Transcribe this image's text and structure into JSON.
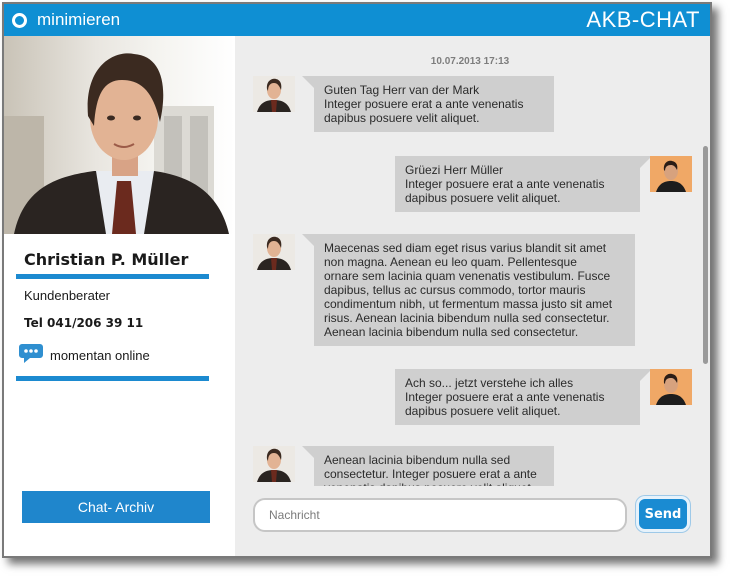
{
  "titlebar": {
    "minimize_label": "minimieren",
    "brand": "AKB-CHAT"
  },
  "agent": {
    "name": "Christian P. Müller",
    "role": "Kundenberater",
    "phone": "Tel 041/206 39 11",
    "status": "momentan online"
  },
  "sidebar": {
    "archive_button": "Chat- Archiv"
  },
  "chat": {
    "timestamp": "10.07.2013 17:13",
    "messages": [
      {
        "side": "left",
        "text": "Guten Tag Herr van der Mark\nInteger posuere erat a ante venenatis\ndapibus posuere velit aliquet."
      },
      {
        "side": "right",
        "text": "Grüezi Herr Müller\nInteger posuere erat a ante venenatis\ndapibus posuere velit aliquet."
      },
      {
        "side": "left",
        "text": "Maecenas sed diam eget risus varius blandit sit amet\nnon magna. Aenean eu leo quam. Pellentesque\nornare sem lacinia quam venenatis vestibulum. Fusce\ndapibus, tellus ac cursus commodo, tortor mauris\ncondimentum nibh, ut fermentum massa justo sit amet\nrisus. Aenean lacinia bibendum nulla sed consectetur.\nAenean lacinia bibendum nulla sed consectetur."
      },
      {
        "side": "right",
        "text": "Ach so... jetzt verstehe ich alles\nInteger posuere erat a ante venenatis\ndapibus posuere velit aliquet."
      },
      {
        "side": "left",
        "text": "Aenean lacinia bibendum nulla sed\nconsectetur. Integer posuere erat a ante\nvenenatis dapibus posuere velit aliquet."
      }
    ]
  },
  "composer": {
    "placeholder": "Nachricht",
    "send_label": "Send"
  },
  "colors": {
    "accent": "#0f8fd3",
    "bubble": "#cfcfcf",
    "chat_bg": "#ededed"
  },
  "icons": {
    "minimize": "circle-icon",
    "status": "chat-bubble-icon"
  }
}
